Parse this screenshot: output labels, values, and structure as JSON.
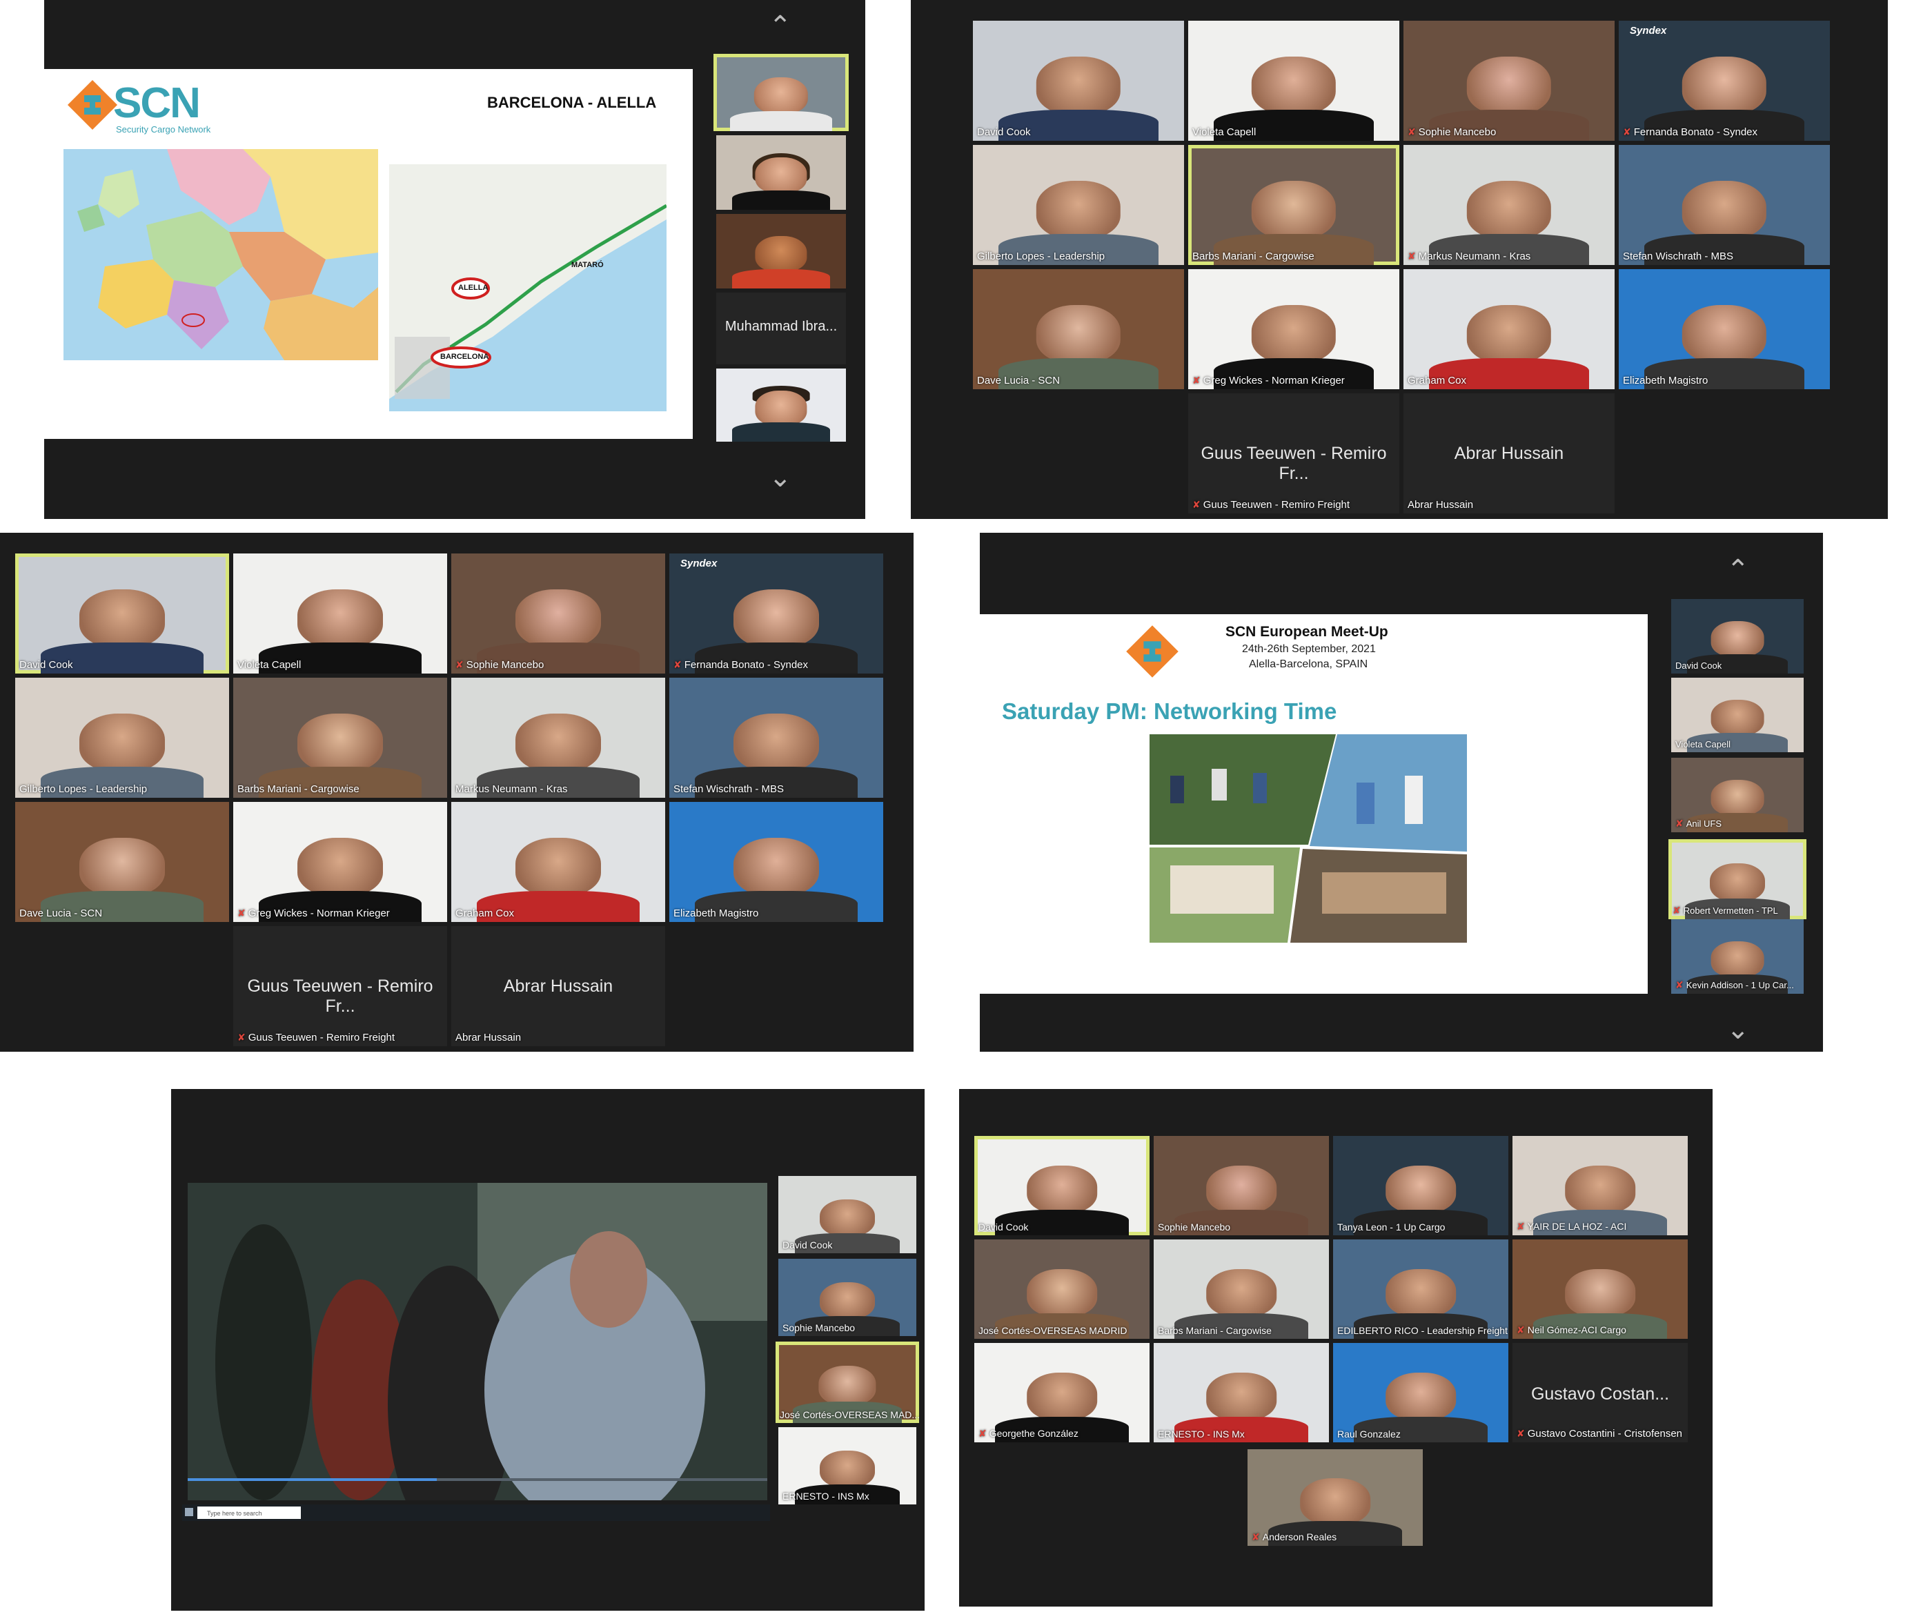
{
  "panel1": {
    "logo_text": "SCN",
    "logo_sub": "Security Cargo Network",
    "title": "BARCELONA - ALELLA",
    "map_labels": [
      "ALELLA",
      "BARCELONA",
      "MATARÓ"
    ],
    "side_name": "Muhammad Ibra..."
  },
  "panel2": {
    "tiles": [
      {
        "name": "David Cook"
      },
      {
        "name": "Violeta Capell"
      },
      {
        "name": "Sophie Mancebo"
      },
      {
        "name": "Fernanda Bonato - Syndex"
      },
      {
        "name": "Gilberto Lopes - Leadership"
      },
      {
        "name": "Barbs Mariani - Cargowise"
      },
      {
        "name": "Markus Neumann - Kras"
      },
      {
        "name": "Stefan Wischrath - MBS"
      },
      {
        "name": "Dave Lucia - SCN"
      },
      {
        "name": "Greg Wickes - Norman Krieger"
      },
      {
        "name": "Graham Cox"
      },
      {
        "name": "Elizabeth Magistro"
      }
    ],
    "blank_tiles": [
      {
        "big": "Guus Teeuwen - Remiro Fr...",
        "name": "Guus Teeuwen - Remiro Freight"
      },
      {
        "big": "Abrar Hussain",
        "name": "Abrar Hussain"
      }
    ],
    "syndex_label": "Syndex"
  },
  "panel3": {
    "tiles": [
      {
        "name": "David Cook"
      },
      {
        "name": "Violeta Capell"
      },
      {
        "name": "Sophie Mancebo"
      },
      {
        "name": "Fernanda Bonato - Syndex"
      },
      {
        "name": "Gilberto Lopes - Leadership"
      },
      {
        "name": "Barbs Mariani - Cargowise"
      },
      {
        "name": "Markus Neumann - Kras"
      },
      {
        "name": "Stefan Wischrath - MBS"
      },
      {
        "name": "Dave Lucia - SCN"
      },
      {
        "name": "Greg Wickes - Norman Krieger"
      },
      {
        "name": "Graham Cox"
      },
      {
        "name": "Elizabeth Magistro"
      }
    ],
    "blank_tiles": [
      {
        "big": "Guus Teeuwen - Remiro Fr...",
        "name": "Guus Teeuwen - Remiro Freight"
      },
      {
        "big": "Abrar Hussain",
        "name": "Abrar Hussain"
      }
    ],
    "syndex_label": "Syndex"
  },
  "panel4": {
    "slide_title": "SCN European Meet-Up",
    "slide_date": "24th-26th September, 2021",
    "slide_place": "Alella-Barcelona, SPAIN",
    "slide_heading": "Saturday PM: Networking Time",
    "side": [
      {
        "name": "David Cook"
      },
      {
        "name": "Violeta Capell"
      },
      {
        "name": "Anil UFS"
      },
      {
        "name": "Robert Vermetten - TPL"
      },
      {
        "name": "Kevin Addison - 1 Up Car..."
      }
    ]
  },
  "panel5": {
    "side": [
      {
        "name": "David Cook"
      },
      {
        "name": "Sophie Mancebo"
      },
      {
        "name": "José Cortés-OVERSEAS MAD..."
      },
      {
        "name": "ERNESTO - INS Mx"
      }
    ],
    "taskbar_search": "Type here to search"
  },
  "panel6": {
    "tiles": [
      {
        "name": "David Cook"
      },
      {
        "name": "Sophie Mancebo"
      },
      {
        "name": "Tanya Leon - 1 Up Cargo"
      },
      {
        "name": "YAIR DE LA HOZ - ACI"
      },
      {
        "name": "José Cortés-OVERSEAS MADRID"
      },
      {
        "name": "Barbs Mariani - Cargowise"
      },
      {
        "name": "EDILBERTO RICO - Leadership Freight"
      },
      {
        "name": "Neil Gómez-ACI Cargo"
      },
      {
        "name": "Georgethe González"
      },
      {
        "name": "ERNESTO - INS Mx"
      },
      {
        "name": "Raul Gonzalez"
      },
      {
        "name": "Gustavo Costantini - Cristofensen"
      },
      {
        "name": "Anderson Reales"
      }
    ],
    "big_name": "Gustavo  Costan..."
  },
  "colors": {
    "panel_bg": "#1c1c1c",
    "highlight": "#d9e67a",
    "scn_orange": "#f0822a",
    "scn_teal": "#3aa2b4"
  }
}
